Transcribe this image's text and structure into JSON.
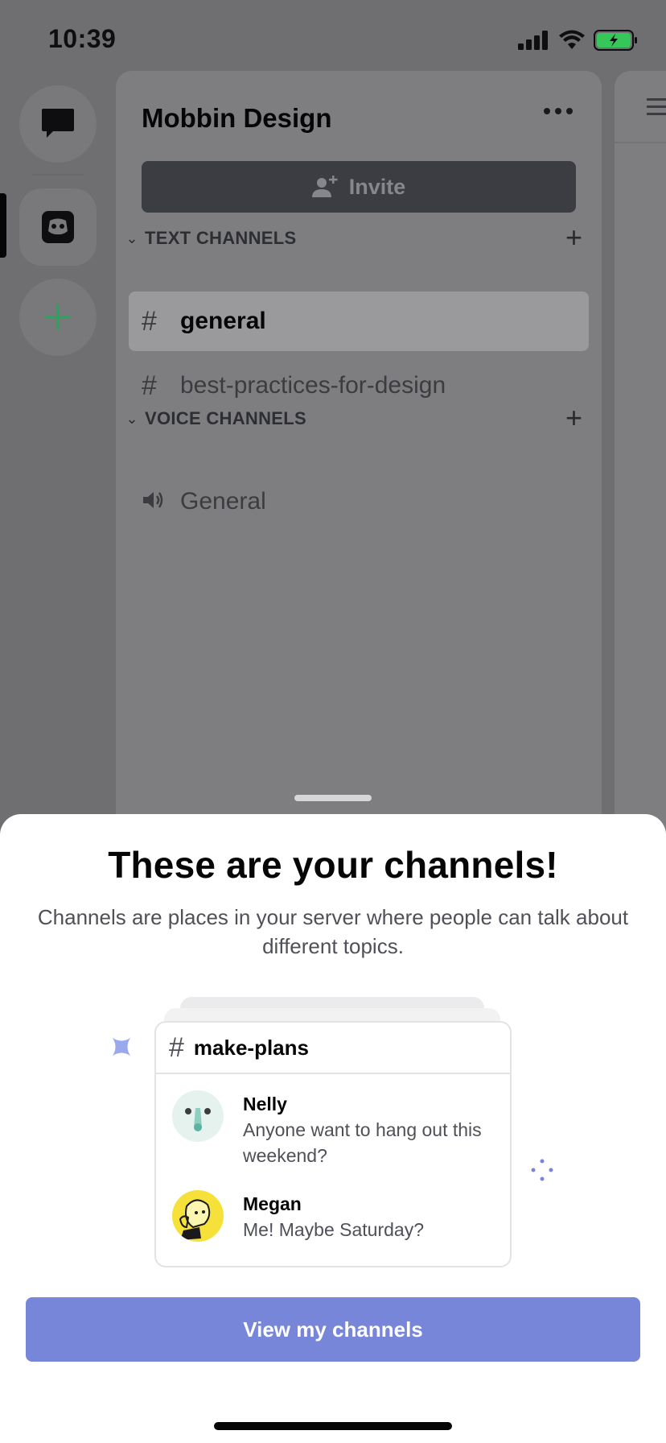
{
  "status": {
    "time": "10:39"
  },
  "server": {
    "name": "Mobbin Design",
    "invite_label": "Invite"
  },
  "categories": {
    "text": {
      "label": "TEXT CHANNELS",
      "channels": [
        {
          "name": "general",
          "selected": true
        },
        {
          "name": "best-practices-for-design",
          "selected": false
        }
      ]
    },
    "voice": {
      "label": "VOICE CHANNELS",
      "channels": [
        {
          "name": "General"
        }
      ]
    }
  },
  "sheet": {
    "title": "These are your channels!",
    "subtitle": "Channels are places in your server where people can talk about different topics.",
    "preview": {
      "channel": "make-plans",
      "messages": [
        {
          "author": "Nelly",
          "text": "Anyone want to hang out this weekend?"
        },
        {
          "author": "Megan",
          "text": "Me! Maybe Saturday?"
        }
      ]
    },
    "cta_label": "View my channels"
  },
  "colors": {
    "blurple": "#7786d8",
    "rail_add": "#2fa060"
  }
}
